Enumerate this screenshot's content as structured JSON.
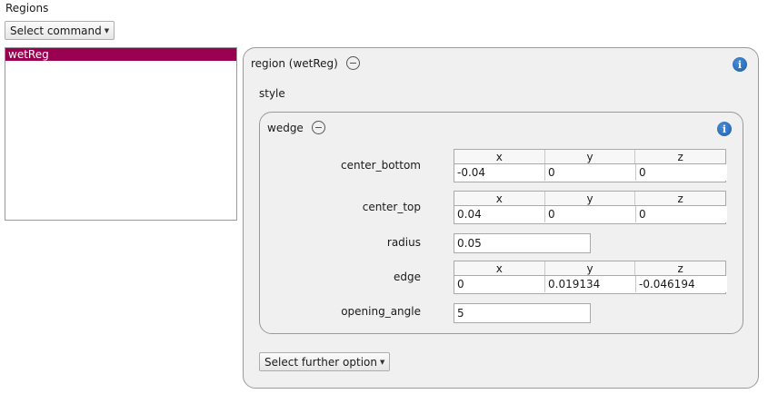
{
  "regions_label": "Regions",
  "select_command": {
    "label": "Select command"
  },
  "region_list": {
    "items": [
      {
        "label": "wetReg",
        "selected": true
      }
    ]
  },
  "region_panel": {
    "title": "region (wetReg)",
    "style_label": "style",
    "wedge": {
      "title": "wedge",
      "center_bottom": {
        "label": "center_bottom",
        "headers": [
          "x",
          "y",
          "z"
        ],
        "values": [
          "-0.04",
          "0",
          "0"
        ]
      },
      "center_top": {
        "label": "center_top",
        "headers": [
          "x",
          "y",
          "z"
        ],
        "values": [
          "0.04",
          "0",
          "0"
        ]
      },
      "radius": {
        "label": "radius",
        "value": "0.05"
      },
      "edge": {
        "label": "edge",
        "headers": [
          "x",
          "y",
          "z"
        ],
        "values": [
          "0",
          "0.019134",
          "-0.046194"
        ]
      },
      "opening_angle": {
        "label": "opening_angle",
        "value": "5"
      }
    },
    "further_option": {
      "label": "Select further option"
    }
  },
  "colors": {
    "selection": "#990050",
    "info_icon": "#1e5aa8",
    "panel_bg": "#f0f0f0"
  },
  "icons": {
    "collapse": "minus-circle-icon",
    "info": "info-icon",
    "dropdown": "dropdown-arrow-icon"
  }
}
